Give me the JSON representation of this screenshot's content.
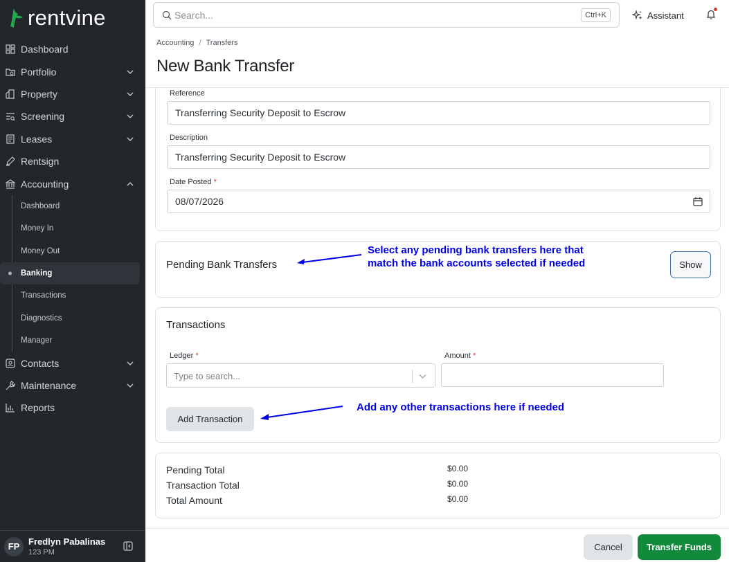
{
  "app": {
    "logo_text": "rentvine",
    "brand_color": "#1faa4f"
  },
  "search": {
    "placeholder": "Search...",
    "shortcut": "Ctrl+K"
  },
  "topbar": {
    "assistant_label": "Assistant"
  },
  "breadcrumb": {
    "items": [
      "Accounting",
      "Transfers"
    ]
  },
  "page": {
    "title": "New Bank Transfer"
  },
  "sidebar": {
    "items": [
      {
        "label": "Dashboard",
        "icon": "dashboard-icon",
        "chevron": false
      },
      {
        "label": "Portfolio",
        "icon": "portfolio-icon",
        "chevron": "down"
      },
      {
        "label": "Property",
        "icon": "property-icon",
        "chevron": "down"
      },
      {
        "label": "Screening",
        "icon": "screening-icon",
        "chevron": "down"
      },
      {
        "label": "Leases",
        "icon": "leases-icon",
        "chevron": "down"
      },
      {
        "label": "Rentsign",
        "icon": "rentsign-icon",
        "chevron": false
      },
      {
        "label": "Accounting",
        "icon": "accounting-icon",
        "chevron": "up"
      }
    ],
    "accounting_sub": [
      "Dashboard",
      "Money In",
      "Money Out",
      "Banking",
      "Transactions",
      "Diagnostics",
      "Manager"
    ],
    "active_sub": "Banking",
    "items_after": [
      {
        "label": "Contacts",
        "icon": "contacts-icon",
        "chevron": "down"
      },
      {
        "label": "Maintenance",
        "icon": "maintenance-icon",
        "chevron": "down"
      },
      {
        "label": "Reports",
        "icon": "reports-icon",
        "chevron": false
      }
    ]
  },
  "user": {
    "initials": "FP",
    "name": "Fredlyn Pabalinas",
    "subtitle": "123 PM"
  },
  "form": {
    "reference": {
      "label": "Reference",
      "value": "Transferring Security Deposit to Escrow"
    },
    "description": {
      "label": "Description",
      "value": "Transferring Security Deposit to Escrow"
    },
    "date_posted": {
      "label": "Date Posted",
      "required_mark": "*",
      "value": "08/07/2026"
    }
  },
  "pending": {
    "title": "Pending Bank Transfers",
    "show_label": "Show"
  },
  "transactions": {
    "title": "Transactions",
    "ledger_label": "Ledger",
    "ledger_placeholder": "Type to search...",
    "amount_label": "Amount",
    "required_mark": "*",
    "add_label": "Add Transaction"
  },
  "totals": [
    {
      "label": "Pending Total",
      "value": "$0.00"
    },
    {
      "label": "Transaction Total",
      "value": "$0.00"
    },
    {
      "label": "Total Amount",
      "value": "$0.00"
    }
  ],
  "annotations": {
    "pending_note_line1": "Select any pending bank transfers here that",
    "pending_note_line2": "match the bank accounts selected if needed",
    "transactions_note": "Add any other transactions here if needed",
    "color": "#0000e6"
  },
  "footer": {
    "cancel_label": "Cancel",
    "submit_label": "Transfer Funds"
  }
}
